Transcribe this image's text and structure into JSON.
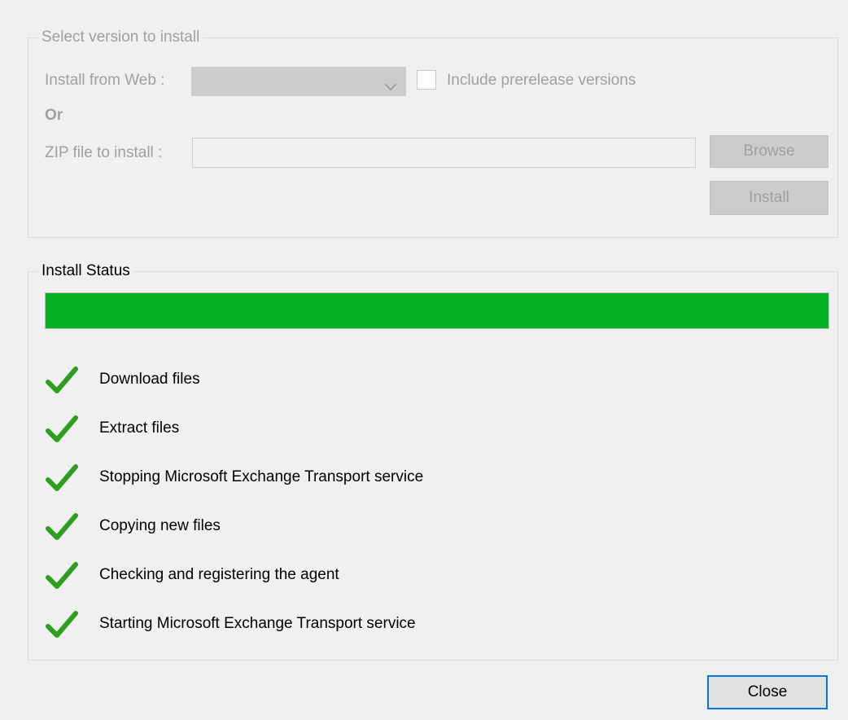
{
  "select_group": {
    "title": "Select version to install",
    "install_from_web_label": "Install from Web :",
    "version_selected": "",
    "include_prerelease_label": "Include prerelease versions",
    "include_prerelease_checked": false,
    "or_label": "Or",
    "zip_label": "ZIP file to install :",
    "zip_value": "",
    "browse_label": "Browse",
    "install_label": "Install"
  },
  "status_group": {
    "title": "Install Status",
    "progress_fraction": 1.0,
    "progress_color": "#06b025",
    "check_color": "#2e9e1f",
    "steps": [
      {
        "icon": "check-icon",
        "label": "Download files"
      },
      {
        "icon": "check-icon",
        "label": "Extract files"
      },
      {
        "icon": "check-icon",
        "label": "Stopping Microsoft Exchange Transport service"
      },
      {
        "icon": "check-icon",
        "label": "Copying new files"
      },
      {
        "icon": "check-icon",
        "label": "Checking and registering the agent"
      },
      {
        "icon": "check-icon",
        "label": "Starting Microsoft Exchange Transport service"
      }
    ]
  },
  "footer": {
    "close_label": "Close"
  }
}
